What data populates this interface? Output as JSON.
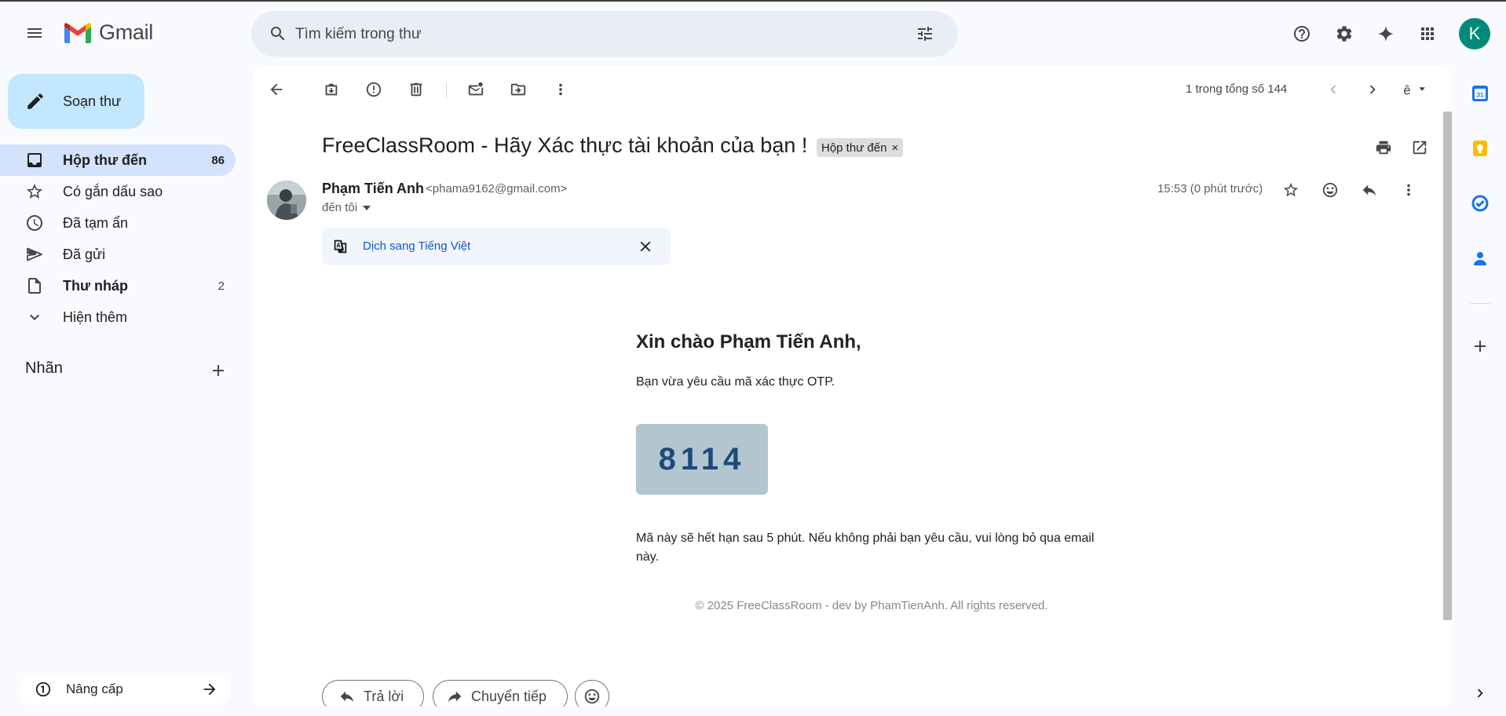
{
  "app": {
    "name": "Gmail"
  },
  "search": {
    "placeholder": "Tìm kiếm trong thư"
  },
  "account": {
    "initial": "K"
  },
  "sidebar": {
    "compose_label": "Soạn thư",
    "items": [
      {
        "label": "Hộp thư đến",
        "count": "86",
        "icon": "inbox-icon",
        "active": true,
        "bold": true
      },
      {
        "label": "Có gắn dấu sao",
        "count": "",
        "icon": "star-icon"
      },
      {
        "label": "Đã tạm ẩn",
        "count": "",
        "icon": "clock-icon"
      },
      {
        "label": "Đã gửi",
        "count": "",
        "icon": "send-icon"
      },
      {
        "label": "Thư nháp",
        "count": "2",
        "icon": "draft-icon",
        "bold": true
      },
      {
        "label": "Hiện thêm",
        "count": "",
        "icon": "chevron-down-icon"
      }
    ],
    "labels_title": "Nhãn",
    "upgrade_label": "Nâng cấp"
  },
  "toolbar": {
    "pager": "1 trong tổng số 144"
  },
  "email": {
    "subject": "FreeClassRoom - Hãy Xác thực tài khoản của bạn !",
    "label_chip": "Hộp thư đến",
    "sender_name": "Phạm Tiến Anh",
    "sender_email": "<phama9162@gmail.com>",
    "to": "đến tôi",
    "time": "15:53 (0 phút trước)",
    "translate_label": "Dịch sang Tiếng Việt",
    "body": {
      "greeting": "Xin chào Phạm Tiến Anh,",
      "intro": "Bạn vừa yêu cầu mã xác thực OTP.",
      "otp": "8114",
      "expire_note": "Mã này sẽ hết hạn sau 5 phút. Nếu không phải bạn yêu cầu, vui lòng bỏ qua email này.",
      "footer": "© 2025 FreeClassRoom - dev by PhamTienAnh. All rights reserved."
    },
    "reply_label": "Trả lời",
    "forward_label": "Chuyển tiếp"
  },
  "colors": {
    "accent": "#0b57d0",
    "compose_bg": "#c2e7ff",
    "active_nav": "#d3e3fd",
    "avatar_bg": "#00897b",
    "otp_bg": "#b3c5cf",
    "otp_text": "#1e4a7a"
  }
}
